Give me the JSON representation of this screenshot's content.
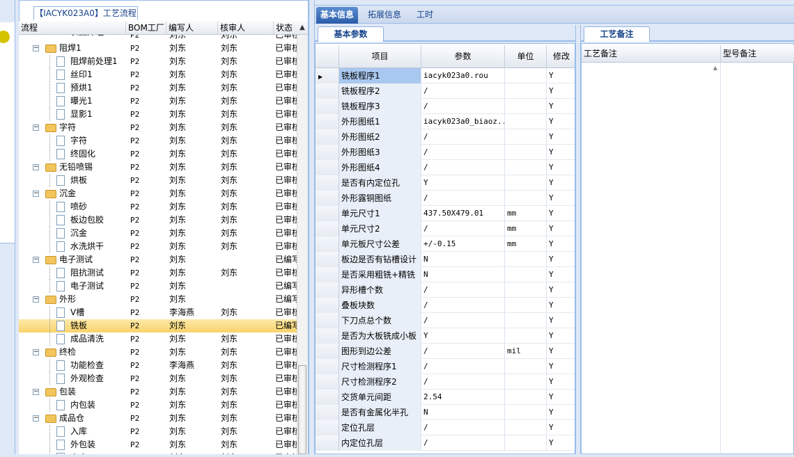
{
  "tree_panel": {
    "tab_title": "【IACYK023A0】工艺流程",
    "columns": [
      "流程",
      "BOM工厂",
      "编写人",
      "核审人",
      "状态"
    ],
    "partial_top_row": {
      "name": "表面外理",
      "bom": "P2",
      "writer": "刘东",
      "reviewer": "刘东",
      "status": "已审核"
    },
    "rows": [
      {
        "level": 1,
        "type": "folder",
        "name": "阻焊1",
        "bom": "P2",
        "writer": "刘东",
        "reviewer": "刘东",
        "status": "已审核"
      },
      {
        "level": 2,
        "type": "doc",
        "name": "阻焊前处理1",
        "bom": "P2",
        "writer": "刘东",
        "reviewer": "刘东",
        "status": "已审核"
      },
      {
        "level": 2,
        "type": "doc",
        "name": "丝印1",
        "bom": "P2",
        "writer": "刘东",
        "reviewer": "刘东",
        "status": "已审核"
      },
      {
        "level": 2,
        "type": "doc",
        "name": "预烘1",
        "bom": "P2",
        "writer": "刘东",
        "reviewer": "刘东",
        "status": "已审核"
      },
      {
        "level": 2,
        "type": "doc",
        "name": "曝光1",
        "bom": "P2",
        "writer": "刘东",
        "reviewer": "刘东",
        "status": "已审核"
      },
      {
        "level": 2,
        "type": "doc",
        "name": "显影1",
        "bom": "P2",
        "writer": "刘东",
        "reviewer": "刘东",
        "status": "已审核"
      },
      {
        "level": 1,
        "type": "folder",
        "name": "字符",
        "bom": "P2",
        "writer": "刘东",
        "reviewer": "刘东",
        "status": "已审核"
      },
      {
        "level": 2,
        "type": "doc",
        "name": "字符",
        "bom": "P2",
        "writer": "刘东",
        "reviewer": "刘东",
        "status": "已审核"
      },
      {
        "level": 2,
        "type": "doc",
        "name": "终固化",
        "bom": "P2",
        "writer": "刘东",
        "reviewer": "刘东",
        "status": "已审核"
      },
      {
        "level": 1,
        "type": "folder",
        "name": "无铅喷锡",
        "bom": "P2",
        "writer": "刘东",
        "reviewer": "刘东",
        "status": "已审核"
      },
      {
        "level": 2,
        "type": "doc",
        "name": "烘板",
        "bom": "P2",
        "writer": "刘东",
        "reviewer": "刘东",
        "status": "已审核"
      },
      {
        "level": 1,
        "type": "folder",
        "name": "沉金",
        "bom": "P2",
        "writer": "刘东",
        "reviewer": "刘东",
        "status": "已审核"
      },
      {
        "level": 2,
        "type": "doc",
        "name": "喷砂",
        "bom": "P2",
        "writer": "刘东",
        "reviewer": "刘东",
        "status": "已审核"
      },
      {
        "level": 2,
        "type": "doc",
        "name": "板边包胶",
        "bom": "P2",
        "writer": "刘东",
        "reviewer": "刘东",
        "status": "已审核"
      },
      {
        "level": 2,
        "type": "doc",
        "name": "沉金",
        "bom": "P2",
        "writer": "刘东",
        "reviewer": "刘东",
        "status": "已审核"
      },
      {
        "level": 2,
        "type": "doc",
        "name": "水洗烘干",
        "bom": "P2",
        "writer": "刘东",
        "reviewer": "刘东",
        "status": "已审核"
      },
      {
        "level": 1,
        "type": "folder",
        "name": "电子测试",
        "bom": "P2",
        "writer": "刘东",
        "reviewer": "",
        "status": "已编写"
      },
      {
        "level": 2,
        "type": "doc",
        "name": "阻抗测试",
        "bom": "P2",
        "writer": "刘东",
        "reviewer": "刘东",
        "status": "已审核"
      },
      {
        "level": 2,
        "type": "doc",
        "name": "电子测试",
        "bom": "P2",
        "writer": "刘东",
        "reviewer": "",
        "status": "已编写"
      },
      {
        "level": 1,
        "type": "folder",
        "name": "外形",
        "bom": "P2",
        "writer": "刘东",
        "reviewer": "",
        "status": "已编写"
      },
      {
        "level": 2,
        "type": "doc",
        "name": "V槽",
        "bom": "P2",
        "writer": "李海燕",
        "reviewer": "刘东",
        "status": "已审核"
      },
      {
        "level": 2,
        "type": "doc",
        "name": "铣板",
        "bom": "P2",
        "writer": "刘东",
        "reviewer": "",
        "status": "已编写",
        "selected": true
      },
      {
        "level": 2,
        "type": "doc",
        "name": "成品清洗",
        "bom": "P2",
        "writer": "刘东",
        "reviewer": "刘东",
        "status": "已审核"
      },
      {
        "level": 1,
        "type": "folder",
        "name": "终检",
        "bom": "P2",
        "writer": "刘东",
        "reviewer": "刘东",
        "status": "已审核"
      },
      {
        "level": 2,
        "type": "doc",
        "name": "功能检查",
        "bom": "P2",
        "writer": "李海燕",
        "reviewer": "刘东",
        "status": "已审核"
      },
      {
        "level": 2,
        "type": "doc",
        "name": "外观检查",
        "bom": "P2",
        "writer": "刘东",
        "reviewer": "刘东",
        "status": "已审核"
      },
      {
        "level": 1,
        "type": "folder",
        "name": "包装",
        "bom": "P2",
        "writer": "刘东",
        "reviewer": "刘东",
        "status": "已审核"
      },
      {
        "level": 2,
        "type": "doc",
        "name": "内包装",
        "bom": "P2",
        "writer": "刘东",
        "reviewer": "刘东",
        "status": "已审核"
      },
      {
        "level": 1,
        "type": "folder",
        "name": "成品仓",
        "bom": "P2",
        "writer": "刘东",
        "reviewer": "刘东",
        "status": "已审核"
      },
      {
        "level": 2,
        "type": "doc",
        "name": "入库",
        "bom": "P2",
        "writer": "刘东",
        "reviewer": "刘东",
        "status": "已审核"
      },
      {
        "level": 2,
        "type": "doc",
        "name": "外包装",
        "bom": "P2",
        "writer": "刘东",
        "reviewer": "刘东",
        "status": "已审核"
      },
      {
        "level": 2,
        "type": "doc",
        "name": "出库",
        "bom": "P2",
        "writer": "刘东",
        "reviewer": "刘东",
        "status": "已审核"
      }
    ]
  },
  "top_tabs": [
    "基本信息",
    "拓展信息",
    "工时"
  ],
  "params_panel": {
    "tab_title": "基本参数",
    "columns": [
      "项目",
      "参数",
      "单位",
      "修改"
    ],
    "rows": [
      {
        "item": "铣板程序1",
        "param": "iacyk023a0.rou",
        "unit": "",
        "mod": "Y",
        "current": true
      },
      {
        "item": "铣板程序2",
        "param": "/",
        "unit": "",
        "mod": "Y"
      },
      {
        "item": "铣板程序3",
        "param": "/",
        "unit": "",
        "mod": "Y"
      },
      {
        "item": "外形图纸1",
        "param": "iacyk023a0_biaoz...",
        "unit": "",
        "mod": "Y"
      },
      {
        "item": "外形图纸2",
        "param": "/",
        "unit": "",
        "mod": "Y"
      },
      {
        "item": "外形图纸3",
        "param": "/",
        "unit": "",
        "mod": "Y"
      },
      {
        "item": "外形图纸4",
        "param": "/",
        "unit": "",
        "mod": "Y"
      },
      {
        "item": "是否有内定位孔",
        "param": "Y",
        "unit": "",
        "mod": "Y"
      },
      {
        "item": "外形露铜图纸",
        "param": "/",
        "unit": "",
        "mod": "Y"
      },
      {
        "item": "单元尺寸1",
        "param": "437.50X479.01",
        "unit": "mm",
        "mod": "Y"
      },
      {
        "item": "单元尺寸2",
        "param": "/",
        "unit": "mm",
        "mod": "Y"
      },
      {
        "item": "单元板尺寸公差",
        "param": "+/-0.15",
        "unit": "mm",
        "mod": "Y"
      },
      {
        "item": "板边是否有钻槽设计",
        "param": "N",
        "unit": "",
        "mod": "Y"
      },
      {
        "item": "是否采用粗铣+精铣",
        "param": "N",
        "unit": "",
        "mod": "Y"
      },
      {
        "item": "异形槽个数",
        "param": "/",
        "unit": "",
        "mod": "Y"
      },
      {
        "item": "叠板块数",
        "param": "/",
        "unit": "",
        "mod": "Y"
      },
      {
        "item": "下刀点总个数",
        "param": "/",
        "unit": "",
        "mod": "Y"
      },
      {
        "item": "是否为大板铣成小板",
        "param": "Y",
        "unit": "",
        "mod": "Y"
      },
      {
        "item": "图形到边公差",
        "param": "/",
        "unit": "mil",
        "mod": "Y"
      },
      {
        "item": "尺寸检测程序1",
        "param": "/",
        "unit": "",
        "mod": "Y"
      },
      {
        "item": "尺寸检测程序2",
        "param": "/",
        "unit": "",
        "mod": "Y"
      },
      {
        "item": "交货单元间距",
        "param": "2.54",
        "unit": "",
        "mod": "Y"
      },
      {
        "item": "是否有金属化半孔",
        "param": "N",
        "unit": "",
        "mod": "Y"
      },
      {
        "item": "定位孔层",
        "param": "/",
        "unit": "",
        "mod": "Y"
      },
      {
        "item": "内定位孔层",
        "param": "/",
        "unit": "",
        "mod": "Y"
      }
    ]
  },
  "notes_panel": {
    "tab_title": "工艺备注",
    "columns": [
      "工艺备注",
      "型号备注"
    ]
  },
  "icons": {
    "current_row": "row-pointer-triangle",
    "folder": "folder-icon",
    "doc": "document-icon"
  }
}
